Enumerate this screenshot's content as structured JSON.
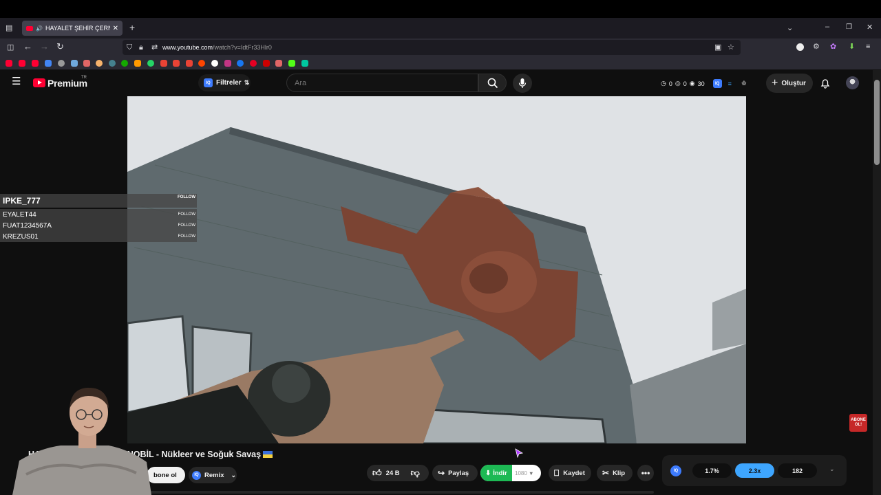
{
  "browser": {
    "tab_title": "HAYALET ŞEHİR ÇERNOBİL",
    "url_host": "www.youtube.com",
    "url_path": "/watch?v=IdtFr33Hlr0"
  },
  "youtube": {
    "logo": "Premium",
    "region": "TR",
    "filters_label": "Filtreler",
    "search_placeholder": "Ara",
    "stats": [
      "0",
      "0",
      "30"
    ],
    "create_label": "Oluştur"
  },
  "overlay": {
    "names": [
      "IPKE_777",
      "EYALET44",
      "FUAT1234567A",
      "KREZUS01"
    ],
    "follow_label": "FOLLOW"
  },
  "video": {
    "title": "HAYALET ŞEHİR ÇERNOBİL - Nükleer ve Soğuk Savaş",
    "title_visible_left": "HAYAL",
    "title_visible_right": "NOBİL - Nükleer ve Soğuk Savaş",
    "subscribe_label": "bone ol",
    "remix_label": "Remix",
    "likes": "24 B",
    "share_label": "Paylaş",
    "download_label": "İndir",
    "download_quality": "1080",
    "save_label": "Kaydet",
    "clip_label": "Klip"
  },
  "panel": {
    "iq_label": "IQ",
    "values": [
      "1.7%",
      "2.3x",
      "182"
    ]
  },
  "badge": {
    "line1": "ABONE",
    "line2": "OL!"
  },
  "colors": {
    "accent_red": "#ff0033",
    "iq_blue": "#3d7bfd",
    "download_green": "#1db954",
    "panel_active": "#3ea6ff"
  }
}
